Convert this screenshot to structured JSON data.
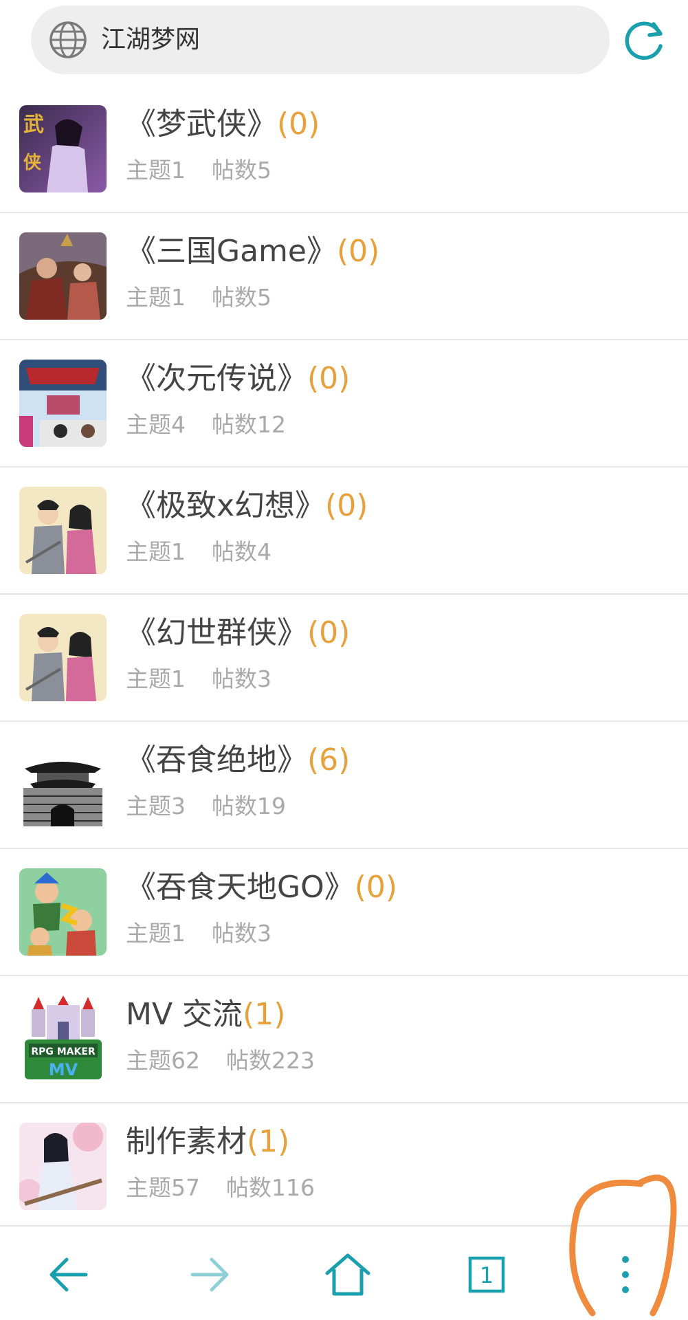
{
  "address_bar": {
    "site_title": "江湖梦网",
    "globe_icon": "globe-icon",
    "reload_icon": "reload-icon"
  },
  "forums": [
    {
      "title": "《梦武侠》",
      "count": "(0)",
      "topics": "主题1",
      "posts": "帖数5"
    },
    {
      "title": "《三国Game》",
      "count": "(0)",
      "topics": "主题1",
      "posts": "帖数5"
    },
    {
      "title": "《次元传说》",
      "count": "(0)",
      "topics": "主题4",
      "posts": "帖数12"
    },
    {
      "title": "《极致x幻想》",
      "count": "(0)",
      "topics": "主题1",
      "posts": "帖数4"
    },
    {
      "title": "《幻世群侠》",
      "count": "(0)",
      "topics": "主题1",
      "posts": "帖数3"
    },
    {
      "title": "《吞食绝地》",
      "count": "(6)",
      "topics": "主题3",
      "posts": "帖数19"
    },
    {
      "title": "《吞食天地GO》",
      "count": "(0)",
      "topics": "主题1",
      "posts": "帖数3"
    },
    {
      "title": "MV 交流",
      "count": "(1)",
      "topics": "主题62",
      "posts": "帖数223"
    },
    {
      "title": "制作素材",
      "count": "(1)",
      "topics": "主题57",
      "posts": "帖数116"
    }
  ],
  "bottom_nav": {
    "back_icon": "arrow-left-icon",
    "forward_icon": "arrow-right-icon",
    "home_icon": "home-icon",
    "tabs_count": "1",
    "menu_icon": "more-vertical-icon"
  },
  "colors": {
    "accent_teal": "#1a9fae",
    "count_orange": "#e8a13a",
    "annotation_orange": "#f08a3c"
  }
}
